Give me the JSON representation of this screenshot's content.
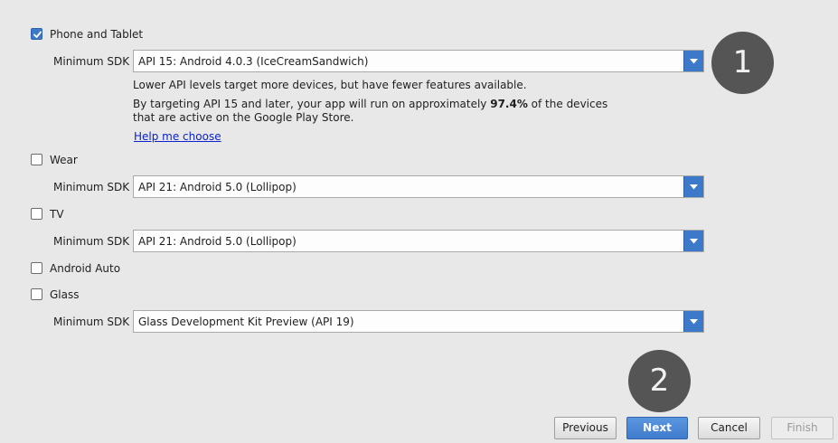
{
  "targets": {
    "phone": {
      "label": "Phone and Tablet",
      "checked": true,
      "sdk_label": "Minimum SDK",
      "sdk_value": "API 15: Android 4.0.3 (IceCreamSandwich)",
      "info_line1": "Lower API levels target more devices, but have fewer features available.",
      "info_line2_pre": "By targeting API 15 and later, your app will run on approximately ",
      "info_line2_pct": "97.4%",
      "info_line2_post": " of the devices",
      "info_line3": "that are active on the Google Play Store.",
      "help_link": "Help me choose"
    },
    "wear": {
      "label": "Wear",
      "checked": false,
      "sdk_label": "Minimum SDK",
      "sdk_value": "API 21: Android 5.0 (Lollipop)"
    },
    "tv": {
      "label": "TV",
      "checked": false,
      "sdk_label": "Minimum SDK",
      "sdk_value": "API 21: Android 5.0 (Lollipop)"
    },
    "auto": {
      "label": "Android Auto",
      "checked": false
    },
    "glass": {
      "label": "Glass",
      "checked": false,
      "sdk_label": "Minimum SDK",
      "sdk_value": "Glass Development Kit Preview (API 19)"
    }
  },
  "annotations": {
    "step1": "1",
    "step2": "2"
  },
  "buttons": {
    "previous": "Previous",
    "next": "Next",
    "cancel": "Cancel",
    "finish": "Finish"
  },
  "colors": {
    "accent": "#3d79c9",
    "link": "#0b22cc",
    "annotation_circle": "#555556",
    "background": "#e8e8e8"
  }
}
